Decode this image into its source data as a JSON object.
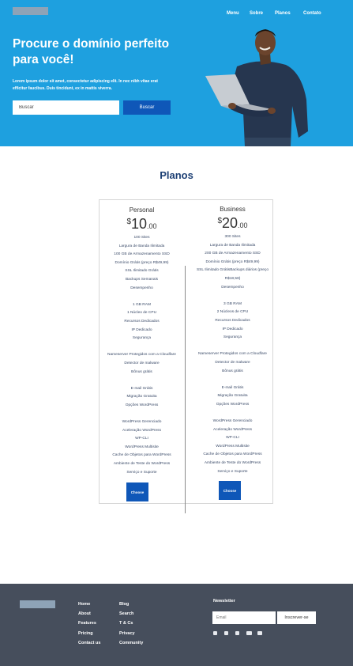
{
  "nav": {
    "items": [
      "Menu",
      "Sobre",
      "Planos",
      "Contato"
    ]
  },
  "hero": {
    "title": "Procure o domínio perfeito para você!",
    "subtitle": "Lorem ipsum dolor sit amet, consectetur adipiscing elit. In nec nibh vitae erat efficitur faucibus. Duis tincidunt, ex in mattis viverra.",
    "search_placeholder": "Buscar",
    "search_button": "Buscar"
  },
  "plans": {
    "title": "Planos",
    "personal": {
      "name": "Personal",
      "currency": "$",
      "price_int": "10",
      "price_cents": ".00",
      "features": [
        "100 Sites",
        "Largura de Banda Ilimitada",
        "100 GB de Armazenamento SSD",
        "Domínio Grátis (preço R$49,99)",
        "SSL Ilimitado Grátis",
        "Backups Semanais",
        "Desempenho",
        "",
        "1 GB RAM",
        "1 Núcleo de CPU",
        "Recursos Dedicados",
        "IP Dedicado",
        "Segurança",
        "",
        "Nameserver Protegidos com a Cloudfare",
        "Detector de malware",
        "Bônus grátis",
        "",
        "E-mail Grátis",
        "Migração Gratuita",
        "Opções WordPress",
        "",
        "WordPress Gerenciado",
        "Aceleração WordPress",
        "WP-CLI",
        "WordPress Multisite",
        "Cache de Objetos para WordPress",
        "Ambiente de Teste do WordPress",
        "Serviço e Suporte"
      ],
      "button": "Choose"
    },
    "business": {
      "name": "Business",
      "currency": "$",
      "price_int": "20",
      "price_cents": ".00",
      "features": [
        "300 Sites",
        "Largura de Banda Ilimitada",
        "200 GB de Armazenamento SSD",
        "Domínio Grátis (preço R$49,99)",
        "SSL Ilimitado GrátisBackups diários (preço",
        "R$18,58)",
        "Desempenho",
        "",
        "3 GB RAM",
        "2 Núcleos de CPU",
        "Recursos Dedicados",
        "IP Dedicado",
        "Segurança",
        "",
        "Nameserver Protegidos com a Cloudfare",
        "Detector de malware",
        "Bônus grátis",
        "",
        "E-mail Grátis",
        "Migração Gratuita",
        "Opções WordPress",
        "",
        "WordPress Gerenciado",
        "Aceleração WordPress",
        "WP-CLI",
        "WordPress Multisite",
        "Cache de Objetos para WordPress",
        "Ambiente de Teste do WordPress",
        "Serviço e Suporte"
      ],
      "button": "Choose"
    }
  },
  "footer": {
    "col1": [
      "Home",
      "About",
      "Features",
      "Pricing",
      "Contact us"
    ],
    "col2": [
      "Blog",
      "Search",
      "T & Cs",
      "Privacy",
      "Community"
    ],
    "newsletter_title": "Newsletter",
    "email_placeholder": "Email",
    "subscribe_button": "Inscrever-se",
    "social_icons": [
      "facebook-icon",
      "instagram-icon",
      "tiktok-icon",
      "twitter-icon",
      "youtube-icon"
    ]
  },
  "colors": {
    "hero_bg": "#1ea0df",
    "primary_button": "#0f57b8",
    "plans_title": "#1c3f74",
    "footer_bg": "#464e5c"
  }
}
